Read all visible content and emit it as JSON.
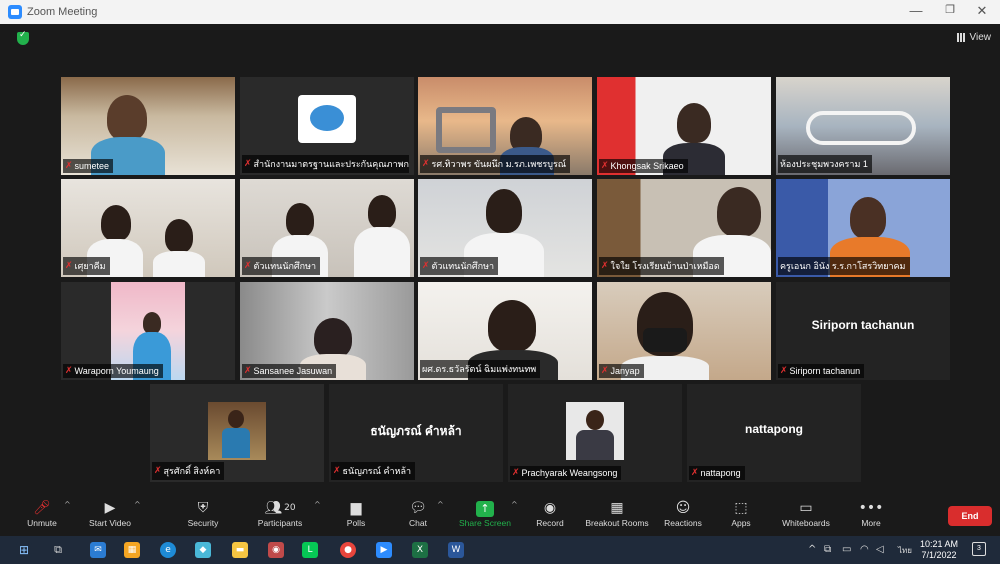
{
  "window": {
    "title": "Zoom Meeting",
    "minimize": "—",
    "maximize": "❐",
    "close": "✕"
  },
  "top_right": {
    "view_label": "View"
  },
  "participants": [
    {
      "name": "sumetee"
    },
    {
      "name": "สำนักงานมาตรฐานและประกันคุณภาพการ..."
    },
    {
      "name": "รศ.ทิวาพร ขันผนึก ม.รภ.เพชรบูรณ์"
    },
    {
      "name": "Khongsak Srikaeo"
    },
    {
      "name": "ห้องประชุมพวงคราม 1"
    },
    {
      "name": "เศุยาคีม"
    },
    {
      "name": "ตัวแทนนักศึกษา"
    },
    {
      "name": "ตัวแทนนักศึกษา"
    },
    {
      "name": "ใจใย โรงเรียนบ้านป่าเหมือด"
    },
    {
      "name": "ครูเอนก อินัง ร.ร.กาโสรวิทยาคม"
    },
    {
      "name": "Waraporn Youmaung"
    },
    {
      "name": "Sansanee Jasuwan"
    },
    {
      "name": "ผศ.ดร.ธวัลรัตน์ ฉิมแพ่งทนทพ"
    },
    {
      "name": "Janyap"
    },
    {
      "name": "Siriporn tachanun",
      "display_name": "Siriporn tachanun"
    },
    {
      "name": "สุรศักดิ์ สิงห์คา"
    },
    {
      "name": "ธนัญภรณ์ คำหล้า",
      "display_name": "ธนัญภรณ์ คำหล้า"
    },
    {
      "name": "Prachyarak Weangsong"
    },
    {
      "name": "nattapong",
      "display_name": "nattapong"
    }
  ],
  "toolbar": {
    "unmute": "Unmute",
    "start_video": "Start Video",
    "security": "Security",
    "participants": "Participants",
    "participant_count": "20",
    "polls": "Polls",
    "chat": "Chat",
    "share_screen": "Share Screen",
    "record": "Record",
    "breakout_rooms": "Breakout Rooms",
    "reactions": "Reactions",
    "apps": "Apps",
    "whiteboards": "Whiteboards",
    "more": "More",
    "end": "End"
  },
  "taskbar": {
    "time": "10:21 AM",
    "date": "7/1/2022",
    "language": "ไทย",
    "notification_count": "3"
  },
  "colors": {
    "accent": "#2d8cff",
    "share_green": "#22b14c",
    "end_red": "#d92d2d",
    "speaker_outline": "#d8e23a"
  }
}
